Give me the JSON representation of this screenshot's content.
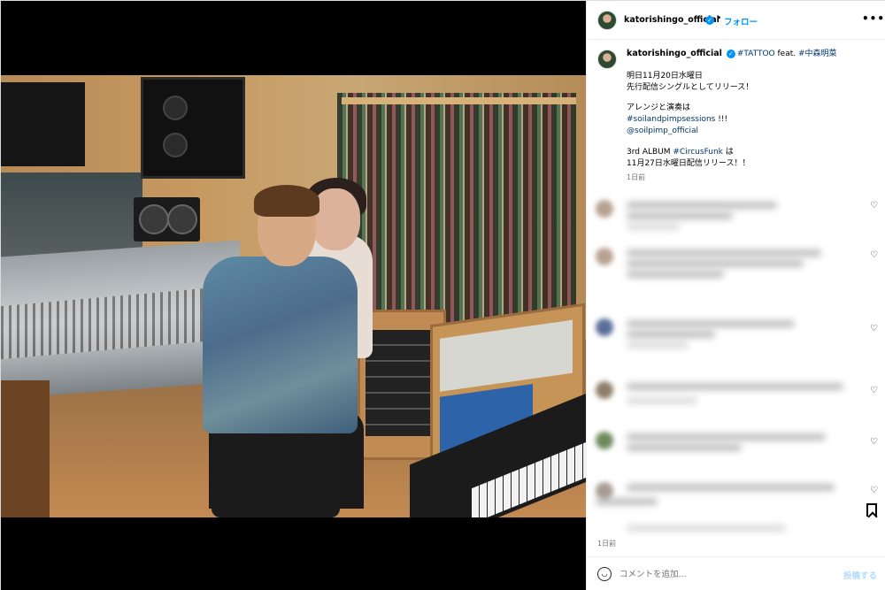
{
  "account": {
    "username": "katorishingo_official",
    "follow_label": "フォロー",
    "dot": "•",
    "more_label": "•••"
  },
  "caption": {
    "username": "katorishingo_official",
    "tag1": "#TATTOO",
    "feat": " feat. ",
    "tag2": "#中森明菜",
    "line1": "明日11月20日水曜日",
    "line2": "先行配信シングルとしてリリース！",
    "line3": "アレンジと演奏は",
    "tag3": "#soilandpimpsessions",
    "tag3_suffix": " !!!",
    "mention": "@soilpimp_official",
    "line4_prefix": "3rd ALBUM ",
    "tag4": "#CircusFunk",
    "line4_suffix": " は",
    "line5": "11月27日水曜日配信リリース！！",
    "time": "1日前"
  },
  "footer": {
    "time": "1日前",
    "comment_placeholder": "コメントを追加...",
    "post_label": "投稿する"
  },
  "icons": {
    "verified": "verified-icon",
    "heart": "heart-icon",
    "bookmark": "bookmark-icon",
    "emoji": "emoji-icon",
    "more": "more-icon"
  },
  "colors": {
    "link": "#00376b",
    "follow": "#0095f6",
    "post_disabled": "#b3dbff"
  }
}
